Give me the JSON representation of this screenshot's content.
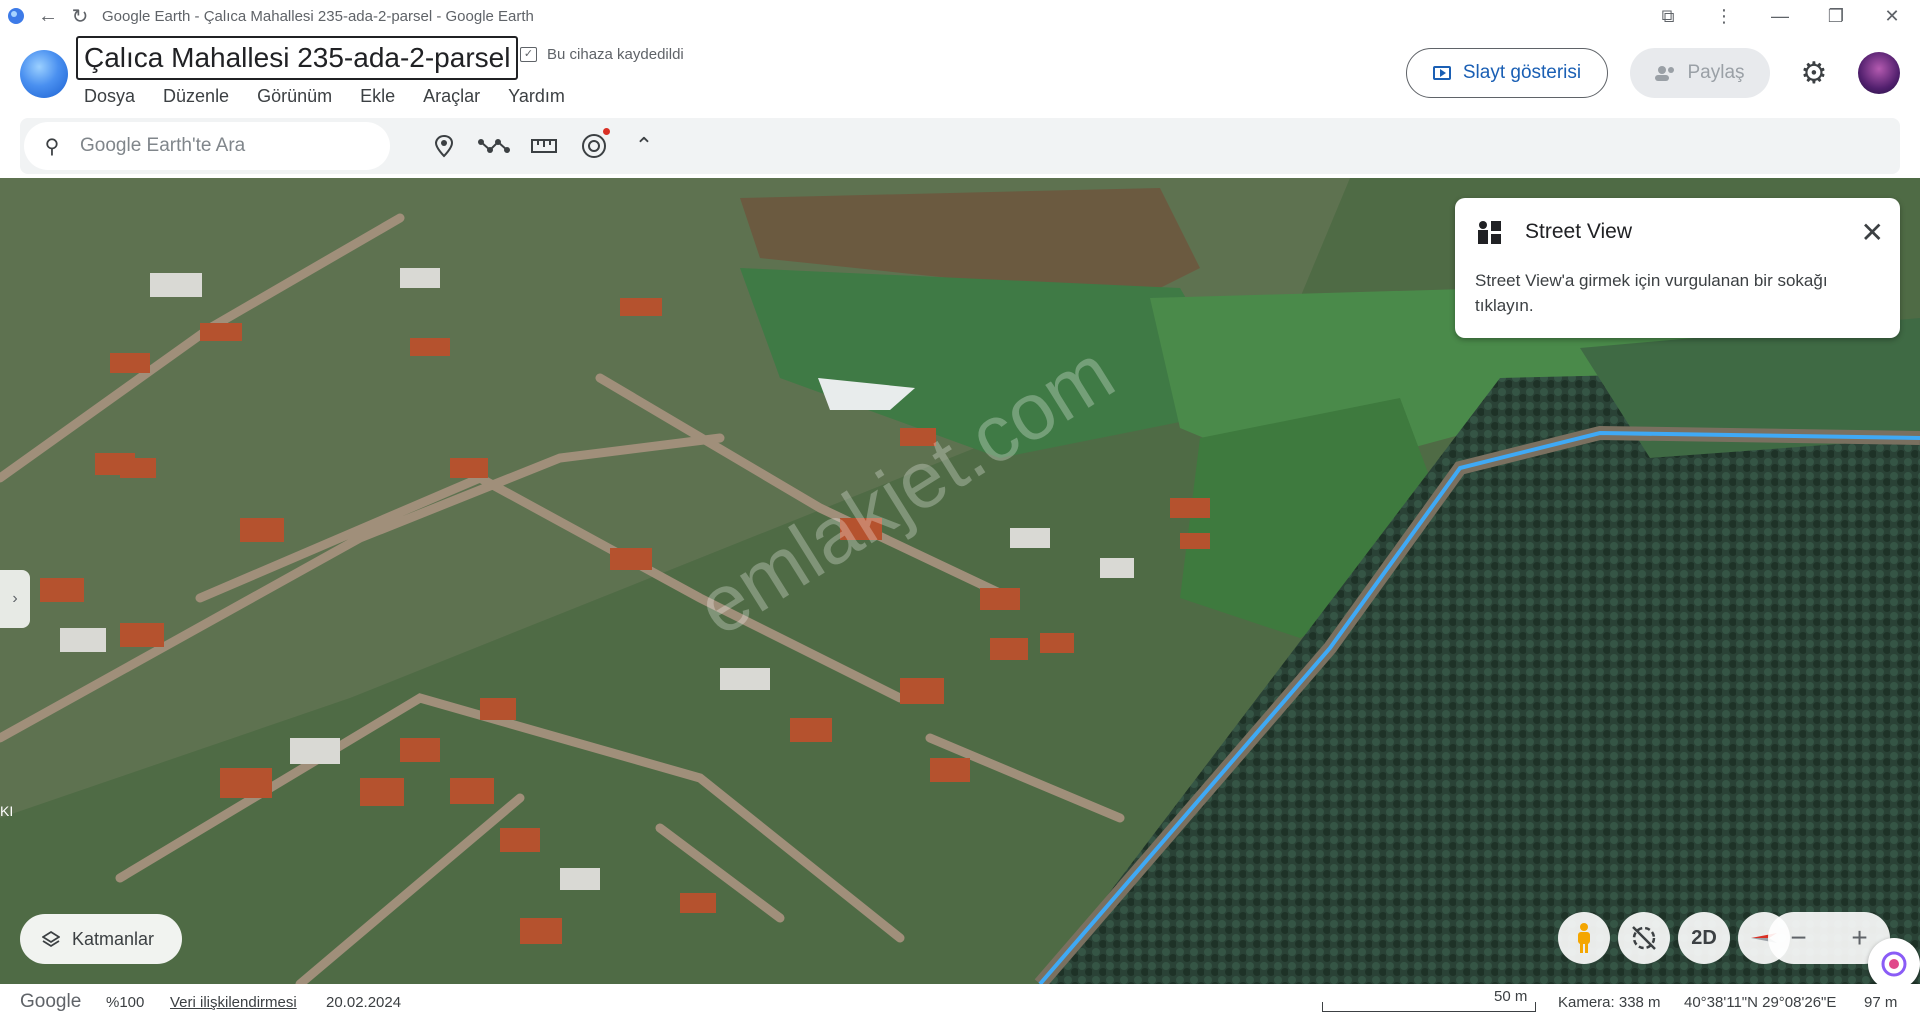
{
  "window": {
    "title": "Google Earth - Çalıca Mahallesi 235-ada-2-parsel - Google Earth"
  },
  "header": {
    "doc_title": "Çalıca Mahallesi 235-ada-2-parsel",
    "saved_status": "Bu cihaza kaydedildi",
    "menu": [
      "Dosya",
      "Düzenle",
      "Görünüm",
      "Ekle",
      "Araçlar",
      "Yardım"
    ],
    "slideshow_label": "Slayt gösterisi",
    "share_label": "Paylaş"
  },
  "toolbar": {
    "search_placeholder": "Google Earth'te Ara"
  },
  "street_view": {
    "title": "Street View",
    "text": "Street View'a girmek için vurgulanan bir sokağı tıklayın."
  },
  "map": {
    "watermark": "emlakjet.com",
    "edge_label": "KI"
  },
  "controls": {
    "layers_label": "Katmanlar",
    "mode_label": "2D",
    "zoom_out": "−",
    "zoom_in": "+"
  },
  "status": {
    "brand": "Google",
    "zoom": "%100",
    "attribution": "Veri ilişkilendirmesi",
    "date": "20.02.2024",
    "scale": "50 m",
    "camera": "Kamera: 338 m",
    "coords": "40°38'11\"N 29°08'26\"E",
    "elevation": "97 m"
  },
  "colors": {
    "accent": "#1a5fb4",
    "street_view_line": "#3fa9f5"
  }
}
